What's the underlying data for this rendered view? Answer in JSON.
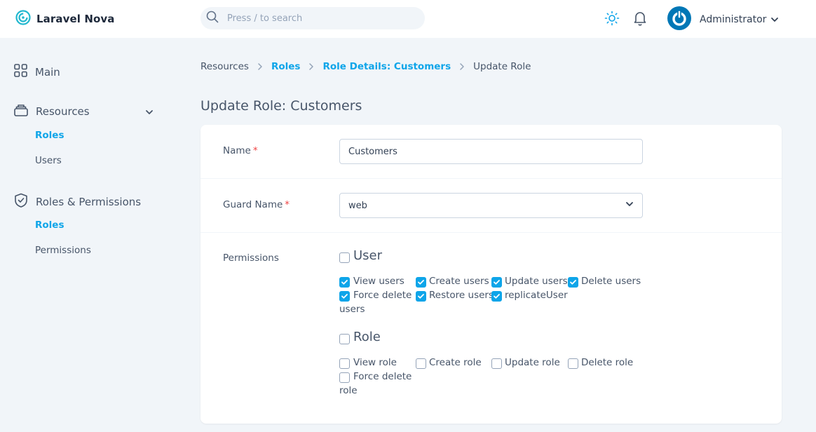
{
  "app": {
    "title": "Laravel Nova"
  },
  "search": {
    "placeholder": "Press / to search"
  },
  "user": {
    "name": "Administrator"
  },
  "sidebar": {
    "main_label": "Main",
    "resources_label": "Resources",
    "resources_items": [
      "Roles",
      "Users"
    ],
    "roles_permissions_label": "Roles & Permissions",
    "rp_items": [
      "Roles",
      "Permissions"
    ]
  },
  "breadcrumb": [
    "Resources",
    "Roles",
    "Role Details: Customers",
    "Update Role"
  ],
  "page_title": "Update Role: Customers",
  "form": {
    "name_label": "Name",
    "required_mark": "*",
    "name_value": "Customers",
    "guard_label": "Guard Name",
    "guard_value": "web",
    "permissions_label": "Permissions",
    "groups": [
      {
        "title": "User",
        "checked": false,
        "items": [
          {
            "label": "View users",
            "checked": true
          },
          {
            "label": "Create users",
            "checked": true
          },
          {
            "label": "Update users",
            "checked": true
          },
          {
            "label": "Delete users",
            "checked": true
          },
          {
            "label_line1": "Force delete",
            "label_line2": "users",
            "checked": true
          },
          {
            "label": "Restore users",
            "checked": true
          },
          {
            "label": "replicateUser",
            "checked": true
          }
        ]
      },
      {
        "title": "Role",
        "checked": false,
        "items": [
          {
            "label": "View role",
            "checked": false
          },
          {
            "label": "Create role",
            "checked": false
          },
          {
            "label": "Update role",
            "checked": false
          },
          {
            "label": "Delete role",
            "checked": false
          },
          {
            "label_line1": "Force delete",
            "label_line2": "role",
            "checked": false
          }
        ]
      }
    ]
  },
  "colors": {
    "accent": "#0ea5e9",
    "required": "#ef4444",
    "background": "#f1f5f9"
  }
}
